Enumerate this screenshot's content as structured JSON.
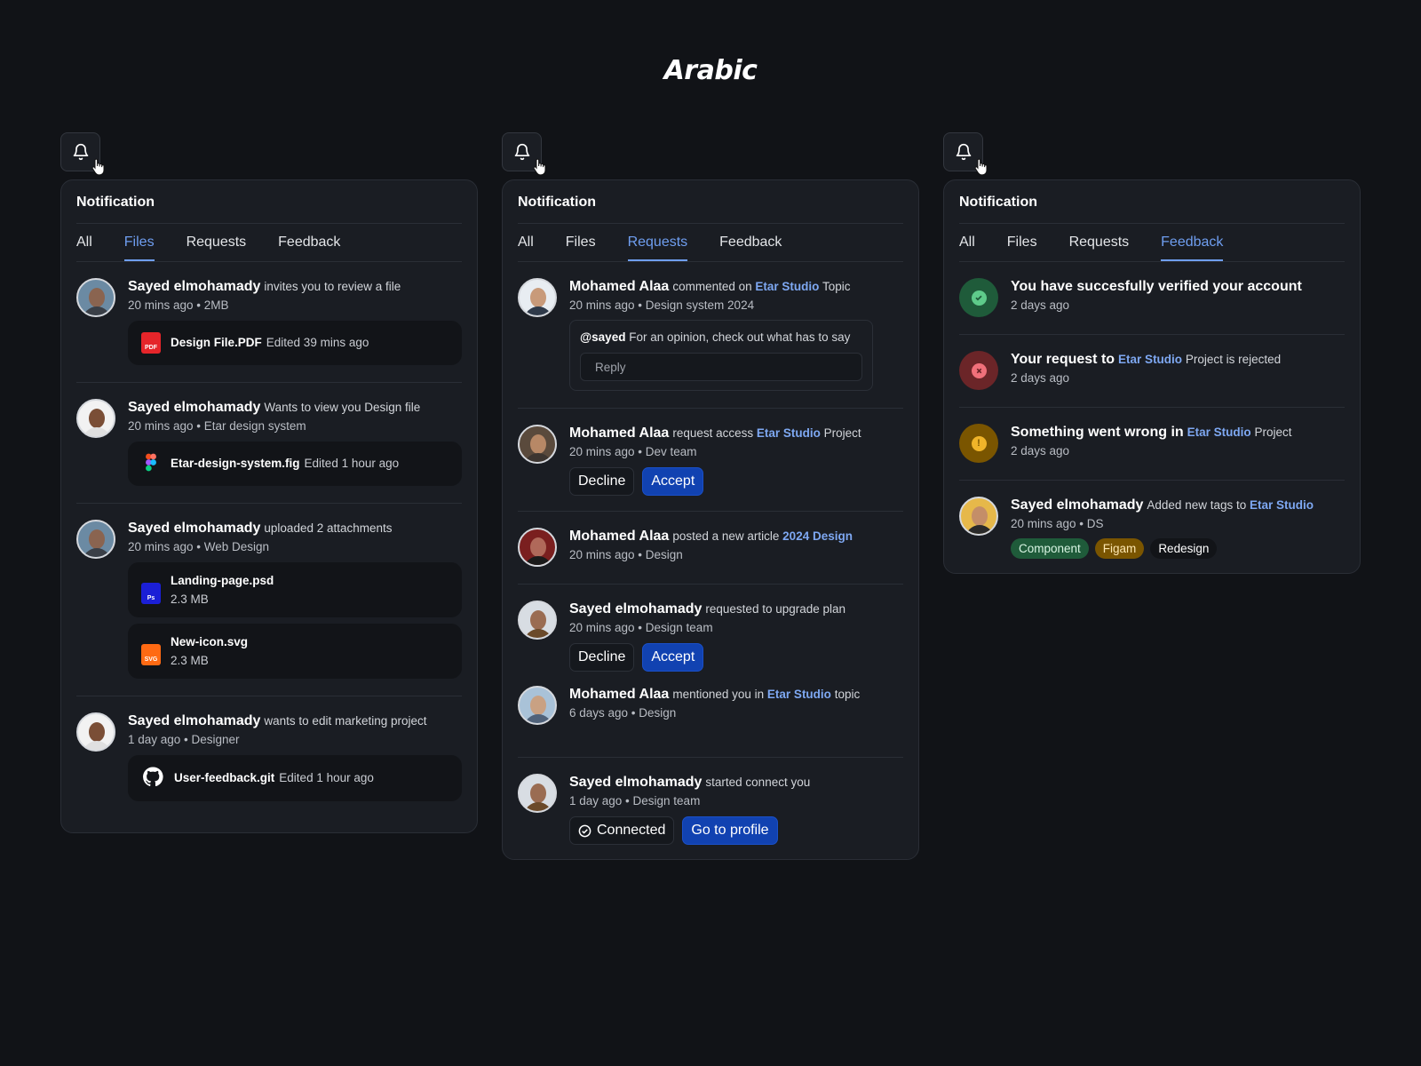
{
  "page": {
    "title": "Arabic"
  },
  "colors": {
    "accent": "#6f9ef0",
    "primary_button": "#1142b1",
    "success": "#2e7d4f",
    "error": "#7a2a2e",
    "warning": "#8a6300"
  },
  "panel1": {
    "title": "Notification",
    "tabs": [
      "All",
      "Files",
      "Requests",
      "Feedback"
    ],
    "active_tab": "Files",
    "items": [
      {
        "name": "Sayed elmohamady",
        "action": "invites you to review a file",
        "meta": "20 mins ago • 2MB",
        "files": [
          {
            "icon": "pdf-icon",
            "name": "Design File.PDF",
            "meta": "Edited 39 mins ago"
          }
        ]
      },
      {
        "name": "Sayed elmohamady",
        "action": "Wants to view you Design file",
        "meta": "20 mins ago • Etar design system",
        "files": [
          {
            "icon": "figma-icon",
            "name": "Etar-design-system.fig",
            "meta": "Edited 1 hour ago"
          }
        ]
      },
      {
        "name": "Sayed elmohamady",
        "action": "uploaded 2 attachments",
        "meta": "20 mins ago • Web Design",
        "files": [
          {
            "icon": "photoshop-icon",
            "name": "Landing-page.psd",
            "sub": "2.3 MB"
          },
          {
            "icon": "svg-file-icon",
            "name": "New-icon.svg",
            "sub": "2.3 MB"
          }
        ]
      },
      {
        "name": "Sayed elmohamady",
        "action": "wants to edit marketing project",
        "meta": "1 day ago • Designer",
        "files": [
          {
            "icon": "github-icon",
            "name": "User-feedback.git",
            "meta": "Edited 1 hour ago"
          }
        ]
      }
    ]
  },
  "panel2": {
    "title": "Notification",
    "tabs": [
      "All",
      "Files",
      "Requests",
      "Feedback"
    ],
    "active_tab": "Requests",
    "items": [
      {
        "name": "Mohamed Alaa",
        "action": "commented on",
        "link": "Etar Studio",
        "suffix": "Topic",
        "meta": "20 mins ago • Design system 2024",
        "comment": {
          "mention": "@sayed",
          "text": "For an opinion, check out what has to say",
          "reply_placeholder": "Reply"
        }
      },
      {
        "name": "Mohamed Alaa",
        "action": "request access",
        "link": "Etar Studio",
        "suffix": "Project",
        "meta": "20 mins ago • Dev team",
        "buttons": {
          "decline": "Decline",
          "accept": "Accept"
        }
      },
      {
        "name": "Mohamed Alaa",
        "action": "posted a new article",
        "link": "2024 Design",
        "suffix": "",
        "meta": "20 mins ago • Design"
      },
      {
        "name": "Sayed elmohamady",
        "action": "requested to upgrade plan",
        "link": "",
        "suffix": "",
        "meta": "20 mins ago • Design team",
        "buttons": {
          "decline": "Decline",
          "accept": "Accept"
        }
      },
      {
        "name": "Mohamed Alaa",
        "action": "mentioned you in",
        "link": "Etar Studio",
        "suffix": "topic",
        "meta": "6 days ago • Design"
      },
      {
        "name": "Sayed elmohamady",
        "action": "started connect you",
        "link": "",
        "suffix": "",
        "meta": "1 day ago • Design team",
        "buttons": {
          "connected": "Connected",
          "profile": "Go to profile"
        }
      }
    ]
  },
  "panel3": {
    "title": "Notification",
    "tabs": [
      "All",
      "Files",
      "Requests",
      "Feedback"
    ],
    "active_tab": "Feedback",
    "items": [
      {
        "status": "success",
        "icon": "check-icon",
        "name": "You have succesfully verified your account",
        "action": "",
        "link": "",
        "suffix": "",
        "meta": "2 days ago"
      },
      {
        "status": "error",
        "icon": "x-icon",
        "name": "Your request to",
        "action": "",
        "link": "Etar Studio",
        "suffix": "Project is rejected",
        "meta": "2 days ago"
      },
      {
        "status": "warning",
        "icon": "alert-icon",
        "name": "Something went wrong in",
        "action": "",
        "link": "Etar Studio",
        "suffix": "Project",
        "meta": "2 days ago"
      },
      {
        "name": "Sayed elmohamady",
        "action": "Added new tags to",
        "link": "Etar Studio",
        "suffix": "",
        "meta": "20 mins ago • DS",
        "tags": [
          "Component",
          "Figam",
          "Redesign"
        ]
      }
    ]
  }
}
